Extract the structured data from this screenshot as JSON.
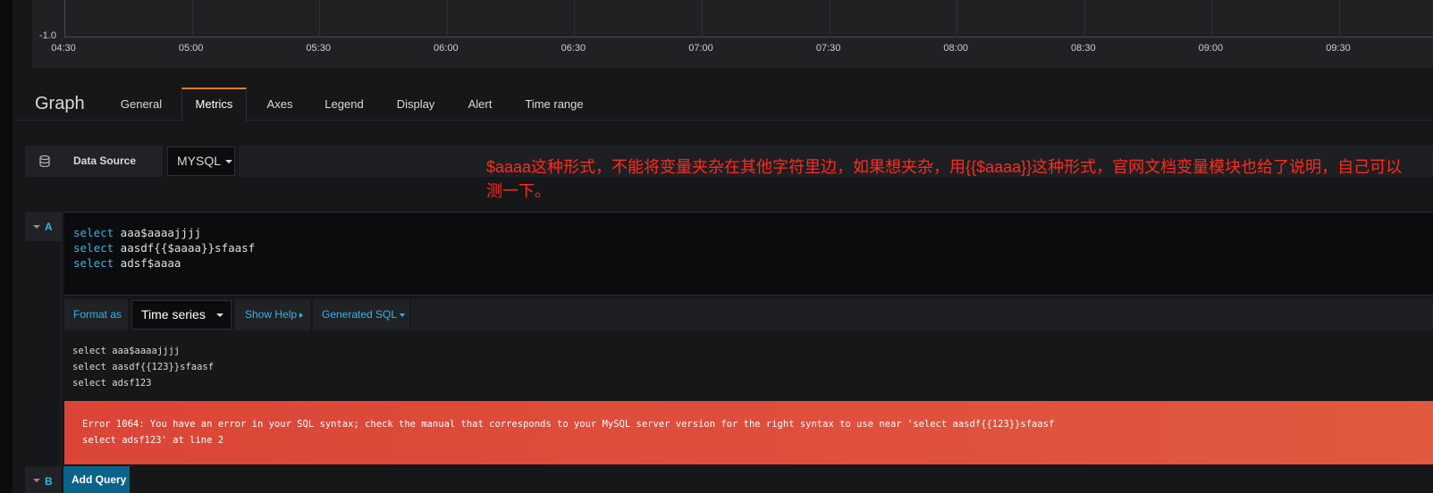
{
  "chart": {
    "y_min_label": "-1.0",
    "x_ticks": [
      "04:30",
      "05:00",
      "05:30",
      "06:00",
      "06:30",
      "07:00",
      "07:30",
      "08:00",
      "08:30",
      "09:00",
      "09:30"
    ]
  },
  "editor": {
    "title": "Graph",
    "tabs": [
      "General",
      "Metrics",
      "Axes",
      "Legend",
      "Display",
      "Alert",
      "Time range"
    ],
    "active_tab": "Metrics"
  },
  "datasource": {
    "label": "Data Source",
    "value": "MYSQL"
  },
  "annotation": {
    "text": "$aaaa这种形式，不能将变量夹杂在其他字符里边，如果想夹杂，用{{$aaaa}}这种形式，官网文档变量模块也给了说明，自己可以测一下。"
  },
  "query_a": {
    "letter": "A",
    "lines": [
      {
        "kw": "select",
        "rest": " aaa$aaaajjjj"
      },
      {
        "kw": "select",
        "rest": " aasdf{{$aaaa}}sfaasf"
      },
      {
        "kw": "select",
        "rest": " adsf$aaaa"
      }
    ],
    "format_label": "Format as",
    "format_value": "Time series",
    "show_help": "Show Help",
    "generated_sql": "Generated SQL",
    "generated_lines": [
      "select aaa$aaaajjjj",
      "select aasdf{{123}}sfaasf",
      "select adsf123"
    ],
    "error_lines": [
      "Error 1064: You have an error in your SQL syntax; check the manual that corresponds to your MySQL server version for the right syntax to use near 'select aasdf{{123}}sfaasf",
      "select adsf123' at line 2"
    ]
  },
  "query_b": {
    "letter": "B",
    "add_query": "Add Query"
  },
  "colors": {
    "accent_blue": "#33b5e5",
    "tab_active_border": "#eb7b18",
    "error_bg": "#e0503d",
    "annotation_red": "#ff2a1e"
  }
}
